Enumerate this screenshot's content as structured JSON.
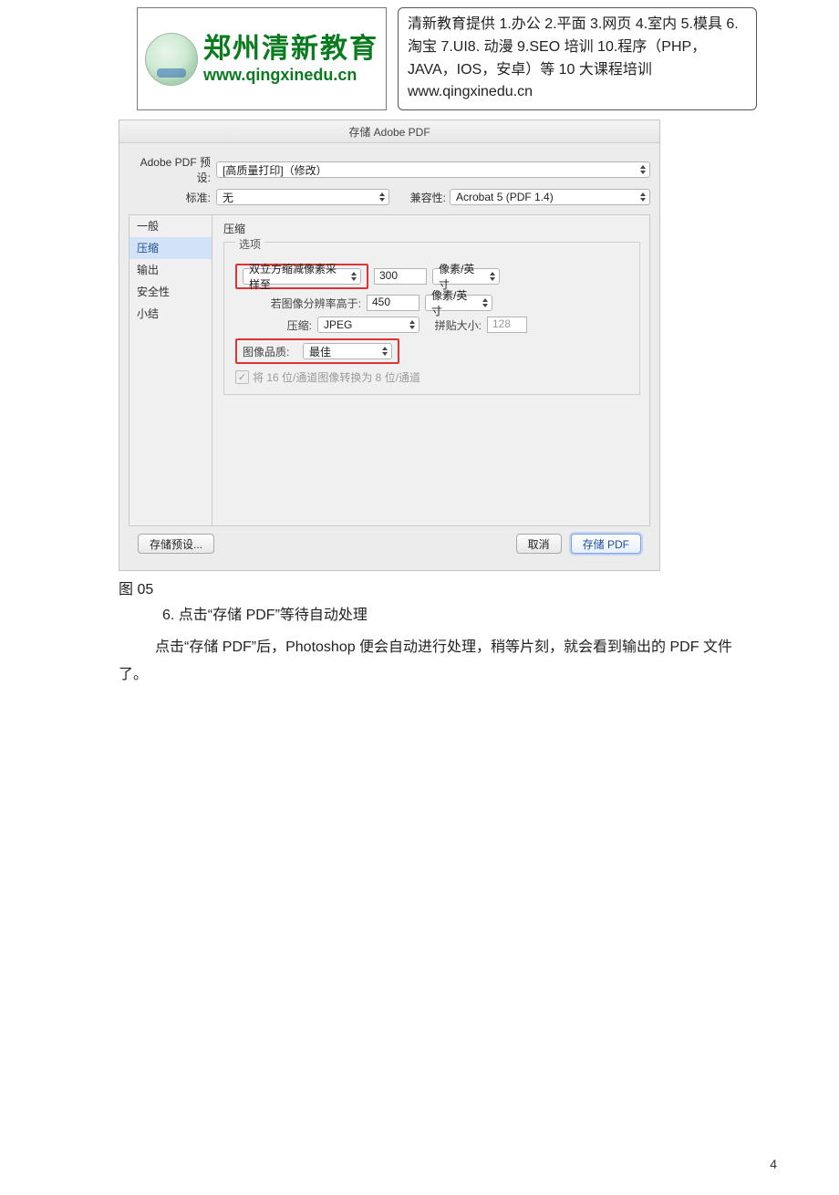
{
  "header": {
    "logo_title": "郑州清新教育",
    "logo_url": "www.qingxinedu.cn",
    "description": "清新教育提供 1.办公 2.平面 3.网页 4.室内 5.模具 6.淘宝 7.UI8.  动漫 9.SEO 培训 10.程序（PHP，JAVA，IOS，安卓）等 10 大课程培训  www.qingxinedu.cn"
  },
  "dialog": {
    "title": "存储 Adobe PDF",
    "preset_label": "Adobe PDF 预设:",
    "preset_value": "[高质量打印]（修改）",
    "standard_label": "标准:",
    "standard_value": "无",
    "compat_label": "兼容性:",
    "compat_value": "Acrobat 5 (PDF 1.4)",
    "tabs": [
      "一般",
      "压缩",
      "输出",
      "安全性",
      "小结"
    ],
    "active_tab_index": 1,
    "section_title": "压缩",
    "group_title": "选项",
    "downsample_label": "双立方缩减像素采样至",
    "downsample_value": "300",
    "unit1": "像素/英寸",
    "threshold_label": "若图像分辨率高于:",
    "threshold_value": "450",
    "unit2": "像素/英寸",
    "compress_label": "压缩:",
    "compress_value": "JPEG",
    "tilesize_label": "拼贴大小:",
    "tilesize_value": "128",
    "quality_label": "图像品质:",
    "quality_value": "最佳",
    "checkbox_label": "将 16 位/通道图像转换为 8 位/通道",
    "save_preset_btn": "存储预设...",
    "cancel_btn": "取消",
    "save_pdf_btn": "存储 PDF"
  },
  "body": {
    "caption": "图 05",
    "step6": "6.  点击“存储 PDF”等待自动处理",
    "para": "点击“存储 PDF”后，Photoshop 便会自动进行处理，稍等片刻，就会看到输出的 PDF 文件了。"
  },
  "page_number": "4"
}
